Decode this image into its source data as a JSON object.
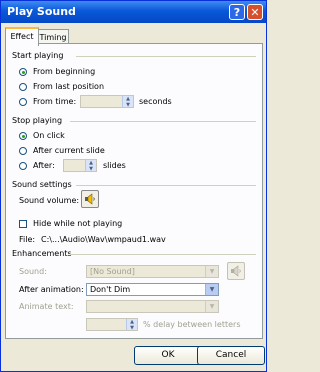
{
  "window": {
    "title": "Play Sound"
  },
  "tabs": [
    {
      "label": "Effect"
    },
    {
      "label": "Timing"
    }
  ],
  "start_playing": {
    "heading": "Start playing",
    "from_beginning": "From beginning",
    "from_last_position": "From last position",
    "from_time": "From time:",
    "seconds": "seconds"
  },
  "stop_playing": {
    "heading": "Stop playing",
    "on_click": "On click",
    "after_current_slide": "After current slide",
    "after": "After:",
    "slides": "slides"
  },
  "sound_settings": {
    "heading": "Sound settings",
    "sound_volume": "Sound volume:",
    "hide_while_not_playing": "Hide while not playing",
    "file_label": "File:",
    "file_path": "C:\\...\\Audio\\Wav\\wmpaud1.wav"
  },
  "enhancements": {
    "heading": "Enhancements",
    "sound_label": "Sound:",
    "sound_value": "[No Sound]",
    "after_animation_label": "After animation:",
    "after_animation_value": "Don't Dim",
    "animate_text_label": "Animate text:",
    "delay_label": "% delay between letters"
  },
  "buttons": {
    "ok": "OK",
    "cancel": "Cancel"
  },
  "icons": {
    "help": "help-icon",
    "close": "close-icon",
    "speaker": "speaker-icon"
  }
}
